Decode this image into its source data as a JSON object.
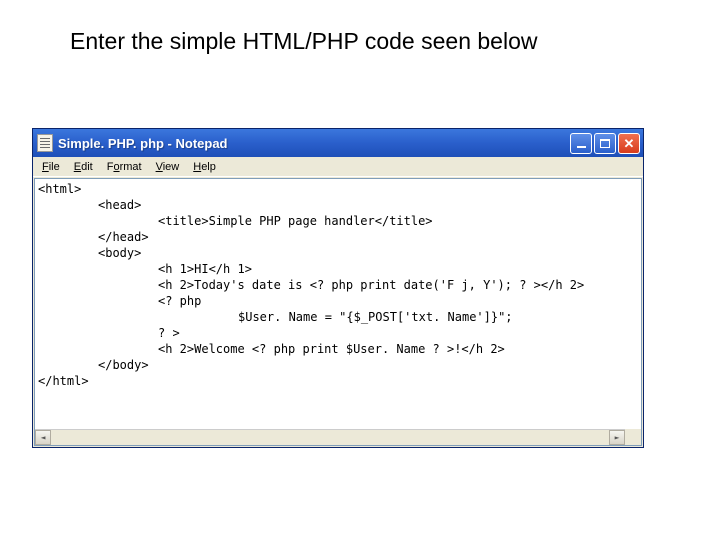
{
  "slide": {
    "heading": "Enter the simple HTML/PHP code seen below"
  },
  "window": {
    "title": "Simple. PHP. php - Notepad",
    "buttons": {
      "min": "minimize",
      "max": "maximize",
      "close": "close"
    }
  },
  "menu": {
    "file": "File",
    "edit": "Edit",
    "format": "Format",
    "view": "View",
    "help": "Help"
  },
  "code": {
    "l1": "<html>",
    "l2": "<head>",
    "l3": "<title>Simple PHP page handler</title>",
    "l4": "</head>",
    "l5": "<body>",
    "l6": "<h 1>HI</h 1>",
    "l7": "<h 2>Today's date is <? php print date('F j, Y'); ? ></h 2>",
    "l8": "<? php",
    "l9": "$User. Name = \"{$_POST['txt. Name']}\";",
    "l10": "? >",
    "l11": "<h 2>Welcome <? php print $User. Name ? >!</h 2>",
    "l12": "</body>",
    "l13": "</html>"
  }
}
